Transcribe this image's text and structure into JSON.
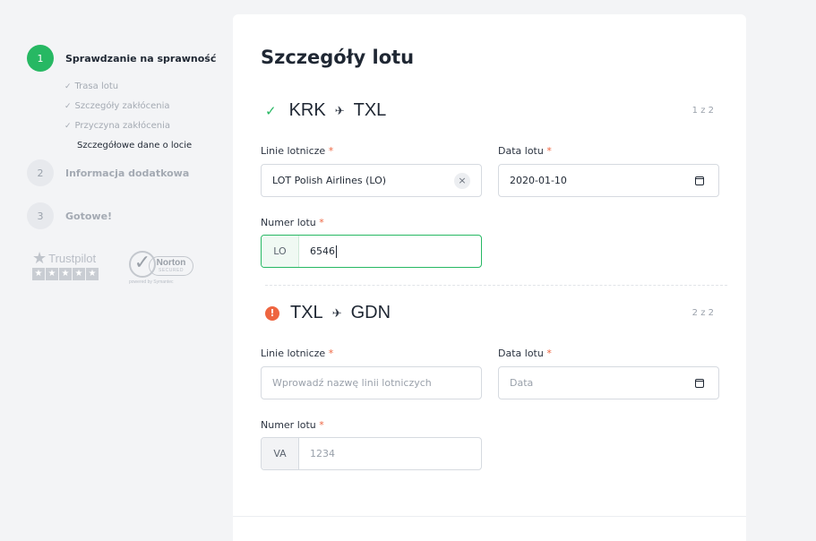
{
  "sidebar": {
    "steps": [
      {
        "number": "1",
        "label": "Sprawdzanie na sprawność"
      },
      {
        "number": "2",
        "label": "Informacja dodatkowa"
      },
      {
        "number": "3",
        "label": "Gotowe!"
      }
    ],
    "substeps": [
      {
        "label": "Trasa lotu"
      },
      {
        "label": "Szczegóły zakłócenia"
      },
      {
        "label": "Przyczyna zakłócenia"
      },
      {
        "label": "Szczegółowe dane o locie"
      }
    ],
    "badges": {
      "trustpilot": "Trustpilot",
      "norton_name": "Norton",
      "norton_sub": "SECURED",
      "norton_powered": "powered by Symantec"
    }
  },
  "main": {
    "title": "Szczegóły lotu",
    "segments": [
      {
        "from": "KRK",
        "to": "TXL",
        "counter": "1 z 2",
        "airline_label": "Linie lotnicze",
        "airline_value": "LOT Polish Airlines (LO)",
        "date_label": "Data lotu",
        "date_value": "2020-01-10",
        "flight_label": "Numer lotu",
        "flight_prefix": "LO",
        "flight_value": "6546"
      },
      {
        "from": "TXL",
        "to": "GDN",
        "counter": "2 z 2",
        "airline_label": "Linie lotnicze",
        "airline_placeholder": "Wprowadź nazwę linii lotniczych",
        "date_label": "Data lotu",
        "date_placeholder": "Data",
        "flight_label": "Numer lotu",
        "flight_prefix": "VA",
        "flight_placeholder": "1234"
      }
    ],
    "required_marker": "*"
  },
  "colors": {
    "accent_green": "#27b863",
    "warning_orange": "#ee6540",
    "background": "#f3f4f6"
  }
}
